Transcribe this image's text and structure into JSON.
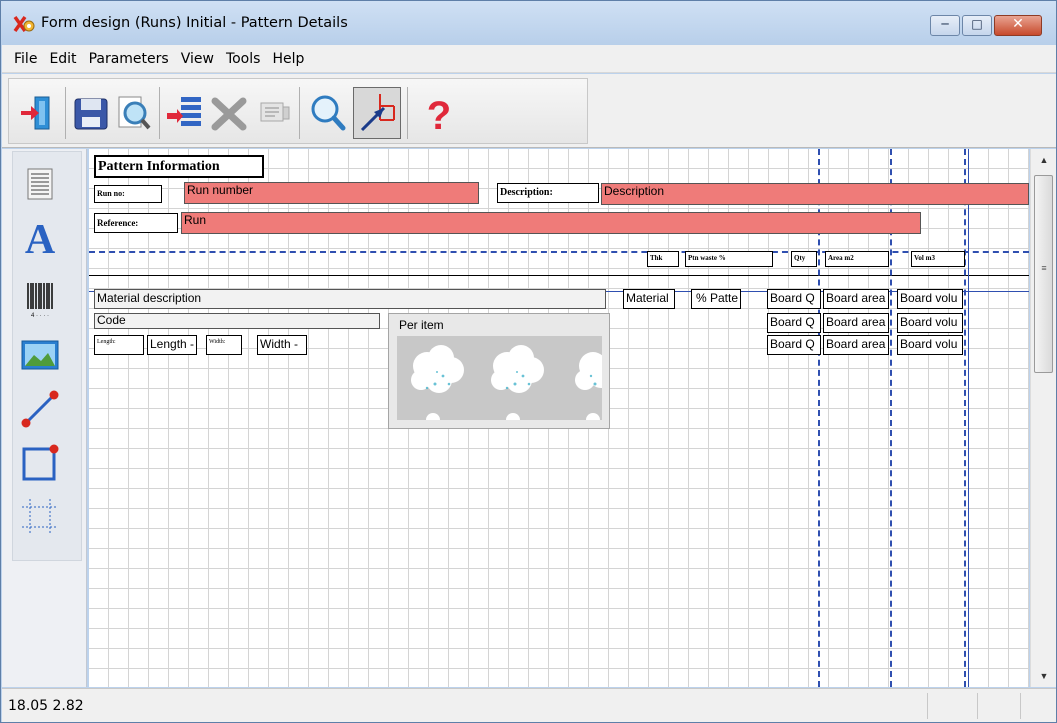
{
  "window": {
    "title": "Form design (Runs) Initial - Pattern Details",
    "minimize_icon": "minimize-icon",
    "maximize_icon": "maximize-icon",
    "close_icon": "close-icon"
  },
  "menu": [
    "File",
    "Edit",
    "Parameters",
    "View",
    "Tools",
    "Help"
  ],
  "toolbar": {
    "buttons": [
      {
        "name": "exit-door-icon"
      },
      {
        "name": "save-disk-icon"
      },
      {
        "name": "print-preview-icon"
      },
      {
        "name": "insert-field-icon"
      },
      {
        "name": "delete-icon"
      },
      {
        "name": "tool-disabled-icon"
      },
      {
        "name": "zoom-icon"
      },
      {
        "name": "select-arrow-icon"
      },
      {
        "name": "help-question-icon"
      }
    ]
  },
  "palette": {
    "tools": [
      "text-document-icon",
      "font-text-icon",
      "barcode-icon",
      "image-icon",
      "line-tool-icon",
      "rectangle-tool-icon",
      "grid-frame-icon"
    ]
  },
  "form": {
    "section_title": "Pattern Information",
    "run_no_label": "Run no:",
    "run_number_field": "Run number",
    "description_label": "Description:",
    "description_field": "Description",
    "reference_label": "Reference:",
    "reference_field": "Run",
    "col_thk": "Thk",
    "col_ptn_waste": "Ptn waste %",
    "col_qty": "Qty",
    "col_area": "Area m2",
    "col_vol": "Vol m3",
    "material_description": "Material description",
    "material": "Material",
    "pct_pattern": "% Patte",
    "board_q1": "Board Q",
    "board_area1": "Board area",
    "board_vol1": "Board volu",
    "code": "Code",
    "board_q2": "Board Q",
    "board_area2": "Board area",
    "board_vol2": "Board volu",
    "length_label": "Length:",
    "length_field": "Length -",
    "width_label": "Width:",
    "width_field": "Width -",
    "board_q3": "Board Q",
    "board_area3": "Board area",
    "board_vol3": "Board volu",
    "per_item": "Per item"
  },
  "status": {
    "coords": "18.05 2.82"
  },
  "colors": {
    "field_red": "#ef7b79",
    "guide_blue": "#2f4fb0"
  }
}
